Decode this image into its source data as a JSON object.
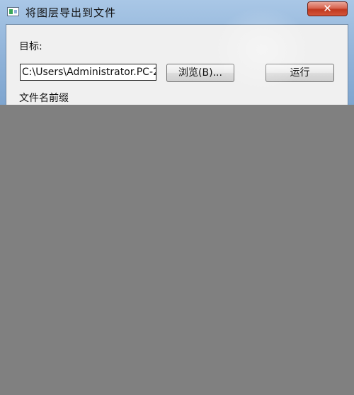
{
  "window": {
    "title": "将图层导出到文件",
    "close_glyph": "✕"
  },
  "form": {
    "target_label": "目标:",
    "path_value": "C:\\Users\\Administrator.PC-2",
    "browse_label": "浏览(B)...",
    "run_label": "运行",
    "prefix_label": "文件名前缀"
  },
  "colors": {
    "overlay_gray": "#808080",
    "client_bg": "#f0f0f0",
    "close_red": "#c0391f"
  }
}
